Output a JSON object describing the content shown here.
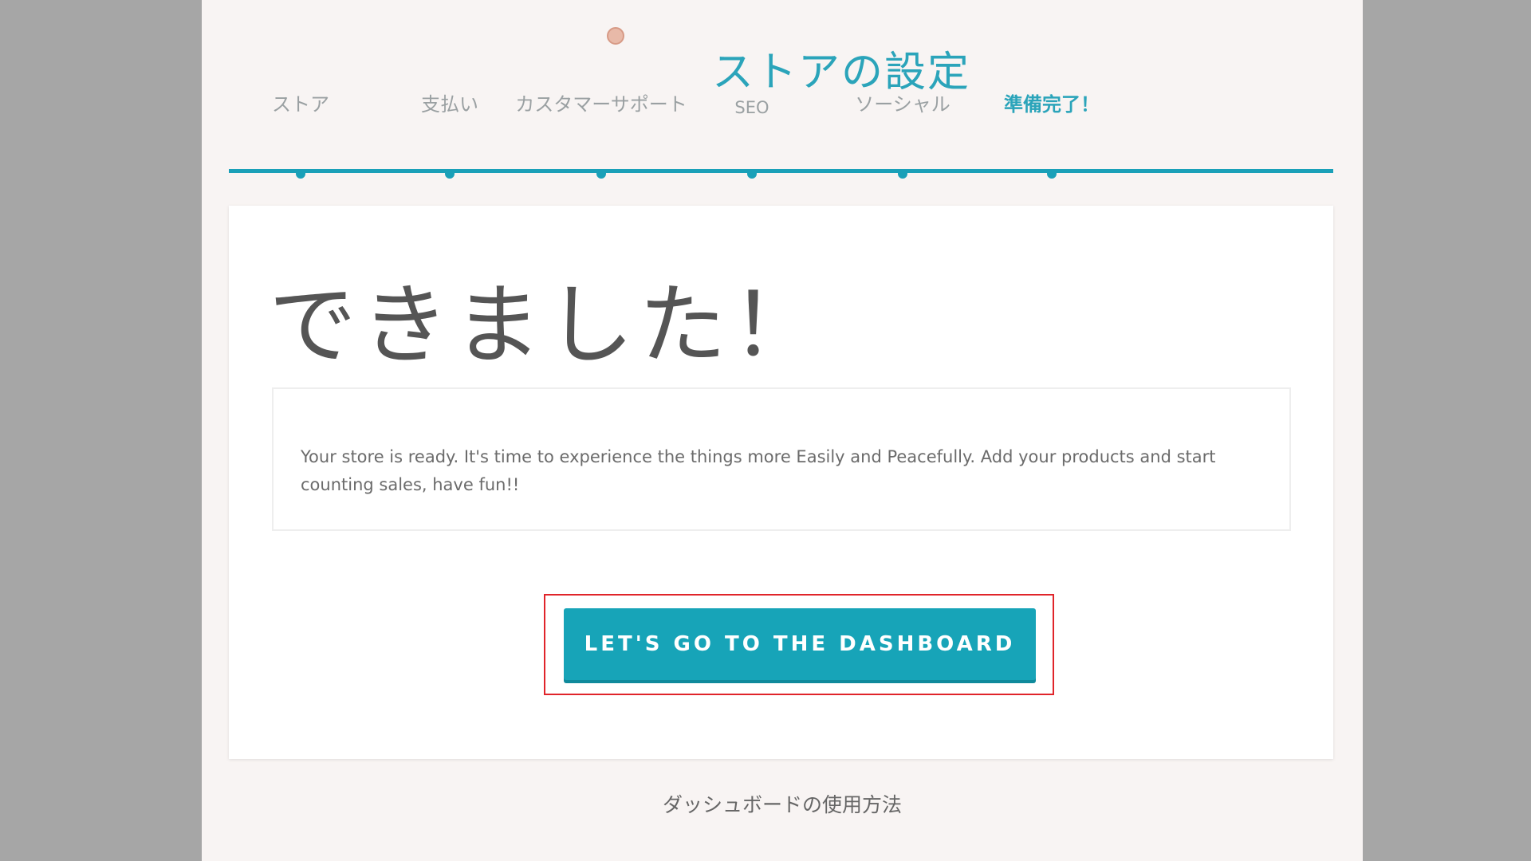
{
  "header": {
    "title": "ストアの設定"
  },
  "steps": [
    {
      "label": "ストア",
      "status": "done"
    },
    {
      "label": "支払い",
      "status": "done"
    },
    {
      "label": "カスタマーサポート",
      "status": "done"
    },
    {
      "label": "SEO",
      "status": "done"
    },
    {
      "label": "ソーシャル",
      "status": "done"
    },
    {
      "label": "準備完了！",
      "status": "current"
    }
  ],
  "main": {
    "headline": "できました！",
    "message": "Your store is ready. It's time to experience the things more Easily and Peacefully. Add your products and start counting sales, have fun!!",
    "cta_label": "LET'S GO TO THE DASHBOARD"
  },
  "footer": {
    "help_link": "ダッシュボードの使用方法"
  },
  "colors": {
    "accent": "#17a4b8",
    "highlight_border": "#e0242a",
    "page_background": "#f8f4f3"
  }
}
